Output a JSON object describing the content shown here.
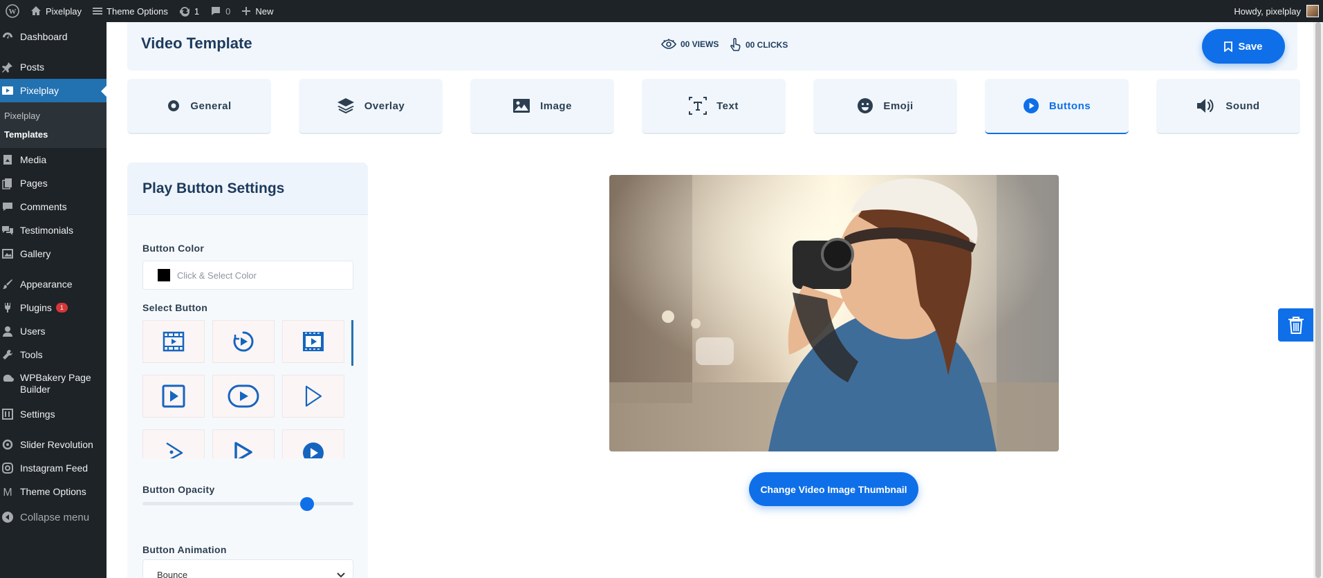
{
  "adminbar": {
    "site_name": "Pixelplay",
    "theme_options": "Theme Options",
    "updates_count": "1",
    "comments_count": "0",
    "new_label": "New",
    "howdy": "Howdy, pixelplay"
  },
  "sidebar": {
    "items": [
      {
        "label": "Dashboard",
        "icon": "dashboard-icon"
      },
      {
        "label": "Posts",
        "icon": "pin-icon"
      },
      {
        "label": "Pixelplay",
        "icon": "video-icon"
      },
      {
        "label": "Media",
        "icon": "media-icon"
      },
      {
        "label": "Pages",
        "icon": "pages-icon"
      },
      {
        "label": "Comments",
        "icon": "comment-icon"
      },
      {
        "label": "Testimonials",
        "icon": "testimonial-icon"
      },
      {
        "label": "Gallery",
        "icon": "gallery-icon"
      },
      {
        "label": "Appearance",
        "icon": "brush-icon"
      },
      {
        "label": "Plugins",
        "icon": "plug-icon",
        "badge": "1"
      },
      {
        "label": "Users",
        "icon": "user-icon"
      },
      {
        "label": "Tools",
        "icon": "wrench-icon"
      },
      {
        "label": "WPBakery Page Builder",
        "icon": "wpbakery-icon"
      },
      {
        "label": "Settings",
        "icon": "settings-icon"
      },
      {
        "label": "Slider Revolution",
        "icon": "refresh-icon"
      },
      {
        "label": "Instagram Feed",
        "icon": "instagram-icon"
      },
      {
        "label": "Theme Options",
        "icon": "m-icon"
      },
      {
        "label": "Collapse menu",
        "icon": "collapse-icon"
      }
    ],
    "submenu": [
      "Pixelplay",
      "Templates"
    ]
  },
  "header": {
    "title": "Video Template",
    "views": "00 VIEWS",
    "clicks": "00 CLICKS",
    "save_label": "Save"
  },
  "tabs": [
    "General",
    "Overlay",
    "Image",
    "Text",
    "Emoji",
    "Buttons",
    "Sound"
  ],
  "active_tab": "Buttons",
  "panel": {
    "title": "Play Button Settings",
    "button_color_label": "Button Color",
    "color_placeholder": "Click & Select Color",
    "color_value": "#000000",
    "select_button_label": "Select Button",
    "opacity_label": "Button Opacity",
    "opacity_value": 0.78,
    "animation_label": "Button Animation",
    "animation_value": "Bounce"
  },
  "preview": {
    "change_button": "Change Video Image Thumbnail"
  },
  "colors": {
    "accent": "#0f6fe8",
    "wp_admin": "#1d2327",
    "wp_active": "#2271b1"
  }
}
